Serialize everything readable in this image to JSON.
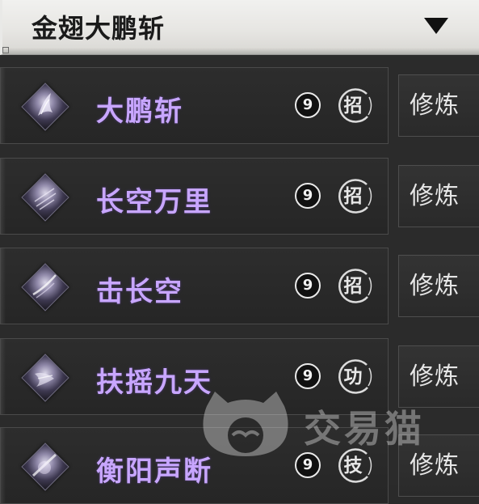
{
  "header": {
    "title": "金翅大鹏斩"
  },
  "skills": [
    {
      "name": "大鹏斩",
      "level": "9",
      "type": "招",
      "action": "修炼"
    },
    {
      "name": "长空万里",
      "level": "9",
      "type": "招",
      "action": "修炼"
    },
    {
      "name": "击长空",
      "level": "9",
      "type": "招",
      "action": "修炼"
    },
    {
      "name": "扶摇九天",
      "level": "9",
      "type": "功",
      "action": "修炼"
    },
    {
      "name": "衡阳声断",
      "level": "9",
      "type": "技",
      "action": "修炼"
    }
  ],
  "watermark": {
    "text": "交易猫"
  },
  "colors": {
    "skill_name": "#c8a6ff",
    "background": "#2a2a2a",
    "header": "#e7e6e3"
  }
}
